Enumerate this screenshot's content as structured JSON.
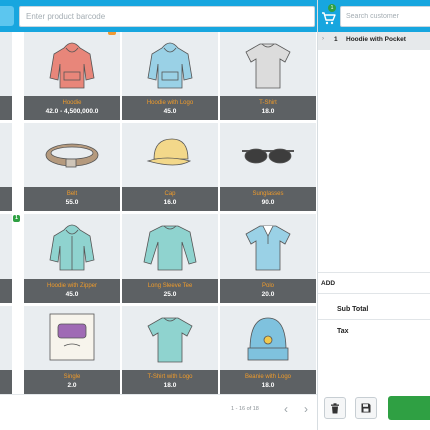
{
  "search": {
    "barcode_placeholder": "Enter product barcode"
  },
  "customer": {
    "placeholder": "Search customer"
  },
  "cart": {
    "count": "1",
    "lines": [
      {
        "qty": "1",
        "name": "Hoodie with Pocket"
      }
    ],
    "add_label": "ADD",
    "subtotal_label": "Sub Total",
    "tax_label": "Tax",
    "delete_icon": "trash-icon",
    "save_icon": "floppy-disk-icon"
  },
  "products": [
    {
      "name": "Hoodie",
      "price": "42.0 - 4,500,000.0",
      "icon": "hoodie-icon",
      "color": "#e8867a",
      "badge": "12"
    },
    {
      "name": "Hoodie with Logo",
      "price": "45.0",
      "icon": "hoodie-icon",
      "color": "#9ad1e6"
    },
    {
      "name": "T-Shirt",
      "price": "18.0",
      "icon": "tshirt-icon",
      "color": "#dcdcdc"
    },
    {
      "name": "Belt",
      "price": "55.0",
      "icon": "belt-icon",
      "color": "#b59a7e"
    },
    {
      "name": "Cap",
      "price": "16.0",
      "icon": "cap-icon",
      "color": "#f3d88a"
    },
    {
      "name": "Sunglasses",
      "price": "90.0",
      "icon": "sunglasses-icon",
      "color": "#3d3d3d"
    },
    {
      "name": "Hoodie with Zipper",
      "price": "45.0",
      "icon": "zip-hoodie-icon",
      "color": "#8fd3cf"
    },
    {
      "name": "Long Sleeve Tee",
      "price": "25.0",
      "icon": "long-sleeve-icon",
      "color": "#8fd3cf"
    },
    {
      "name": "Polo",
      "price": "20.0",
      "icon": "polo-icon",
      "color": "#9ad1e6"
    },
    {
      "name": "Single",
      "price": "2.0",
      "icon": "album-icon",
      "color": "#9f6ab5"
    },
    {
      "name": "T-Shirt with Logo",
      "price": "18.0",
      "icon": "tshirt-icon",
      "color": "#8fd3cf"
    },
    {
      "name": "Beanie with Logo",
      "price": "18.0",
      "icon": "beanie-icon",
      "color": "#7fc2de"
    }
  ],
  "badges": {
    "left_partial_tile": "1"
  },
  "pagination": {
    "text": "1 - 16 of 18",
    "prev": "‹",
    "next": "›"
  }
}
